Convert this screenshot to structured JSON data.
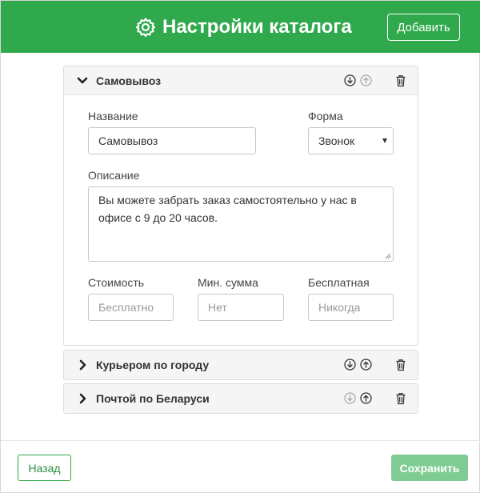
{
  "header": {
    "title": "Настройки каталога",
    "add_label": "Добавить",
    "settings_icon": "gear-icon",
    "color": "#2fa94c"
  },
  "deliveries": [
    {
      "title": "Самовывоз",
      "expanded": true,
      "form": {
        "name_label": "Название",
        "name_value": "Самовывоз",
        "form_label": "Форма",
        "form_value": "Звонок",
        "description_label": "Описание",
        "description_value": "Вы можете забрать заказ самостоятельно у нас в офисе с 9 до 20 часов.",
        "cost_label": "Стоимость",
        "cost_placeholder": "Бесплатно",
        "min_sum_label": "Мин. сумма",
        "min_sum_placeholder": "Нет",
        "free_label": "Бесплатная",
        "free_placeholder": "Никогда"
      }
    },
    {
      "title": "Курьером по городу",
      "expanded": false
    },
    {
      "title": "Почтой по Беларуси",
      "expanded": false
    }
  ],
  "footer": {
    "back_label": "Назад",
    "save_label": "Сохранить",
    "save_color": "#7fcc93"
  }
}
